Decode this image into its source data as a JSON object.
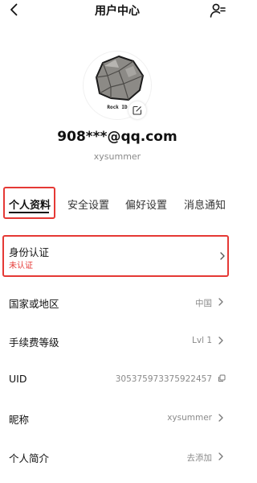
{
  "header": {
    "title": "用户中心",
    "back_icon": "back-arrow-icon",
    "user_icon": "user-switch-icon"
  },
  "profile": {
    "avatar_text": "Rock ID",
    "edit_icon": "edit-icon",
    "email": "908***@qq.com",
    "username": "xysummer"
  },
  "tabs": [
    {
      "label": "个人资料",
      "active": true
    },
    {
      "label": "安全设置",
      "active": false
    },
    {
      "label": "偏好设置",
      "active": false
    },
    {
      "label": "消息通知",
      "active": false
    }
  ],
  "identity": {
    "label": "身份认证",
    "status": "未认证",
    "status_color": "#e53935"
  },
  "rows": [
    {
      "label": "国家或地区",
      "value": "中国"
    },
    {
      "label": "手续费等级",
      "value": "Lvl 1"
    },
    {
      "label": "UID",
      "value": "305375973375922457"
    },
    {
      "label": "昵称",
      "value": "xysummer"
    },
    {
      "label": "个人简介",
      "value": "去添加"
    }
  ],
  "colors": {
    "highlight": "#e53935",
    "text": "#111111",
    "muted": "#8a8a8a"
  }
}
